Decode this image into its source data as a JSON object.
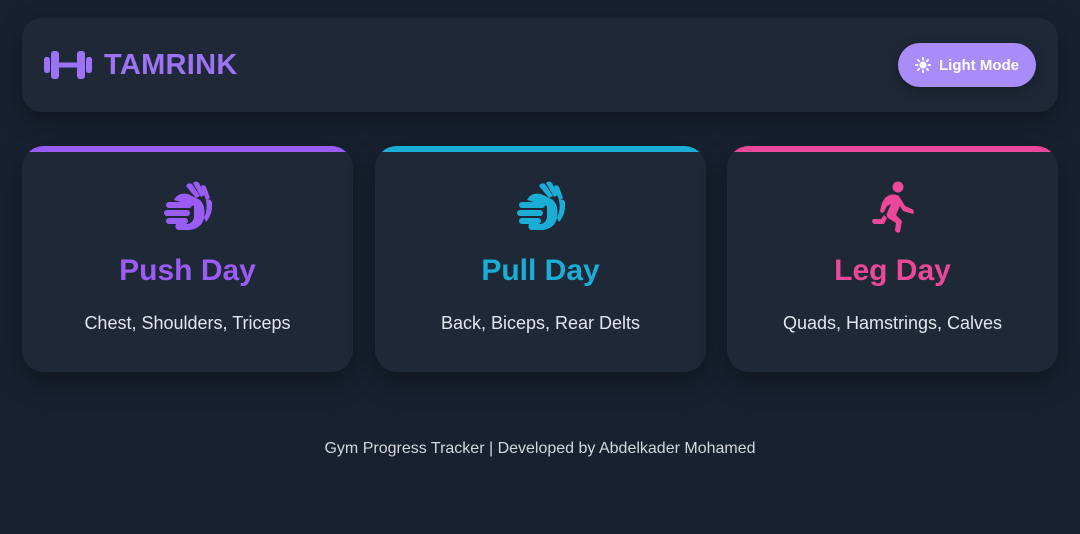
{
  "header": {
    "brand_name": "TAMRINK",
    "brand_icon": "dumbbell-icon",
    "theme_button": {
      "label": "Light Mode",
      "icon": "sun-icon"
    }
  },
  "cards": [
    {
      "title": "Push Day",
      "subtitle": "Chest, Shoulders, Triceps",
      "icon": "clapping-hands-icon",
      "color": "#9b5cf6"
    },
    {
      "title": "Pull Day",
      "subtitle": "Back, Biceps, Rear Delts",
      "icon": "clapping-hands-icon",
      "color": "#1aaed6"
    },
    {
      "title": "Leg Day",
      "subtitle": "Quads, Hamstrings, Calves",
      "icon": "running-person-icon",
      "color": "#ec4899"
    }
  ],
  "footer": {
    "text": "Gym Progress Tracker | Developed by Abdelkader Mohamed"
  },
  "colors": {
    "background": "#172130",
    "panel": "#1f2837",
    "brand": "#9d73f6",
    "button": "#a88cf8"
  }
}
